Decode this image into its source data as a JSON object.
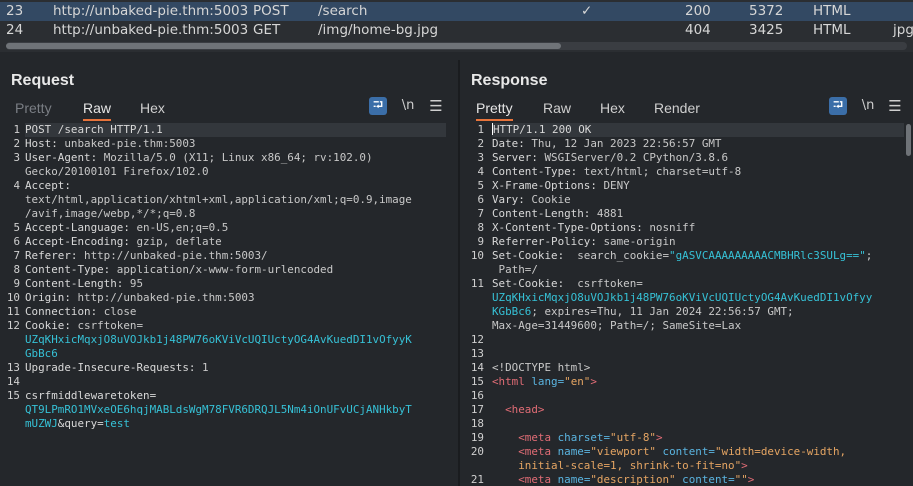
{
  "history": {
    "rows": [
      {
        "num": "23",
        "host": "http://unbaked-pie.thm:5003",
        "method": "POST",
        "path": "/search",
        "check": "✓",
        "status": "200",
        "length": "5372",
        "mime": "HTML",
        "ext": ""
      },
      {
        "num": "24",
        "host": "http://unbaked-pie.thm:5003",
        "method": "GET",
        "path": "/img/home-bg.jpg",
        "check": "",
        "status": "404",
        "length": "3425",
        "mime": "HTML",
        "ext": "jpg"
      }
    ]
  },
  "request": {
    "title": "Request",
    "tabs": [
      "Pretty",
      "Raw",
      "Hex"
    ],
    "active_tab": "Raw",
    "newline_label": "\\n",
    "lines": [
      {
        "n": "1",
        "parts": [
          [
            "k",
            "POST /search HTTP/1.1"
          ]
        ]
      },
      {
        "n": "2",
        "parts": [
          [
            "k",
            "Host: "
          ],
          [
            "v",
            "unbaked-pie.thm:5003"
          ]
        ]
      },
      {
        "n": "3",
        "parts": [
          [
            "k",
            "User-Agent: "
          ],
          [
            "v",
            "Mozilla/5.0 (X11; Linux x86_64; rv:102.0)"
          ]
        ]
      },
      {
        "n": "",
        "parts": [
          [
            "v",
            "Gecko/20100101 Firefox/102.0"
          ]
        ]
      },
      {
        "n": "4",
        "parts": [
          [
            "k",
            "Accept: "
          ]
        ]
      },
      {
        "n": "",
        "parts": [
          [
            "v",
            "text/html,application/xhtml+xml,application/xml;q=0.9,image"
          ]
        ]
      },
      {
        "n": "",
        "parts": [
          [
            "v",
            "/avif,image/webp,*/*;q=0.8"
          ]
        ]
      },
      {
        "n": "5",
        "parts": [
          [
            "k",
            "Accept-Language: "
          ],
          [
            "v",
            "en-US,en;q=0.5"
          ]
        ]
      },
      {
        "n": "6",
        "parts": [
          [
            "k",
            "Accept-Encoding: "
          ],
          [
            "v",
            "gzip, deflate"
          ]
        ]
      },
      {
        "n": "7",
        "parts": [
          [
            "k",
            "Referer: "
          ],
          [
            "v",
            "http://unbaked-pie.thm:5003/"
          ]
        ]
      },
      {
        "n": "8",
        "parts": [
          [
            "k",
            "Content-Type: "
          ],
          [
            "v",
            "application/x-www-form-urlencoded"
          ]
        ]
      },
      {
        "n": "9",
        "parts": [
          [
            "k",
            "Content-Length: "
          ],
          [
            "v",
            "95"
          ]
        ]
      },
      {
        "n": "10",
        "parts": [
          [
            "k",
            "Origin: "
          ],
          [
            "v",
            "http://unbaked-pie.thm:5003"
          ]
        ]
      },
      {
        "n": "11",
        "parts": [
          [
            "k",
            "Connection: "
          ],
          [
            "v",
            "close"
          ]
        ]
      },
      {
        "n": "12",
        "parts": [
          [
            "k",
            "Cookie: "
          ],
          [
            "v",
            "csrftoken="
          ]
        ]
      },
      {
        "n": "",
        "parts": [
          [
            "cyan",
            "UZqKHxicMqxjO8uVOJkb1j48PW76oKViVcUQIUctyOG4AvKuedDI1vOfyyK"
          ]
        ]
      },
      {
        "n": "",
        "parts": [
          [
            "cyan",
            "GbBc6"
          ]
        ]
      },
      {
        "n": "13",
        "parts": [
          [
            "k",
            "Upgrade-Insecure-Requests: "
          ],
          [
            "v",
            "1"
          ]
        ]
      },
      {
        "n": "14",
        "parts": []
      },
      {
        "n": "15",
        "parts": [
          [
            "k",
            "csrfmiddlewaretoken="
          ]
        ]
      },
      {
        "n": "",
        "parts": [
          [
            "cyan",
            "QT9LPmRO1MVxeOE6hqjMABLdsWgM78FVR6DRQJL5Nm4iOnUFvUCjANHkbyT"
          ]
        ]
      },
      {
        "n": "",
        "parts": [
          [
            "cyan",
            "mUZWJ"
          ],
          [
            "k",
            "&query="
          ],
          [
            "cyan",
            "test"
          ]
        ]
      }
    ]
  },
  "response": {
    "title": "Response",
    "tabs": [
      "Pretty",
      "Raw",
      "Hex",
      "Render"
    ],
    "active_tab": "Pretty",
    "newline_label": "\\n",
    "lines": [
      {
        "n": "1",
        "parts": [
          [
            "k",
            "HTTP/1.1 200 OK"
          ]
        ]
      },
      {
        "n": "2",
        "parts": [
          [
            "k",
            "Date: "
          ],
          [
            "v",
            "Thu, 12 Jan 2023 22:56:57 GMT"
          ]
        ]
      },
      {
        "n": "3",
        "parts": [
          [
            "k",
            "Server: "
          ],
          [
            "v",
            "WSGIServer/0.2 CPython/3.8.6"
          ]
        ]
      },
      {
        "n": "4",
        "parts": [
          [
            "k",
            "Content-Type: "
          ],
          [
            "v",
            "text/html; charset=utf-8"
          ]
        ]
      },
      {
        "n": "5",
        "parts": [
          [
            "k",
            "X-Frame-Options: "
          ],
          [
            "v",
            "DENY"
          ]
        ]
      },
      {
        "n": "6",
        "parts": [
          [
            "k",
            "Vary: "
          ],
          [
            "v",
            "Cookie"
          ]
        ]
      },
      {
        "n": "7",
        "parts": [
          [
            "k",
            "Content-Length: "
          ],
          [
            "v",
            "4881"
          ]
        ]
      },
      {
        "n": "8",
        "parts": [
          [
            "k",
            "X-Content-Type-Options: "
          ],
          [
            "v",
            "nosniff"
          ]
        ]
      },
      {
        "n": "9",
        "parts": [
          [
            "k",
            "Referrer-Policy: "
          ],
          [
            "v",
            "same-origin"
          ]
        ]
      },
      {
        "n": "10",
        "parts": [
          [
            "k",
            "Set-Cookie: "
          ],
          [
            "v",
            " search_cookie="
          ],
          [
            "cyan",
            "\"gASVCAAAAAAAAACMBHRlc3SULg==\""
          ],
          [
            "v",
            ";"
          ]
        ]
      },
      {
        "n": "",
        "parts": [
          [
            "v",
            " Path=/"
          ]
        ]
      },
      {
        "n": "11",
        "parts": [
          [
            "k",
            "Set-Cookie: "
          ],
          [
            "v",
            " csrftoken="
          ]
        ]
      },
      {
        "n": "",
        "parts": [
          [
            "cyan",
            "UZqKHxicMqxjO8uVOJkb1j48PW76oKViVcUQIUctyOG4AvKuedDI1vOfyy"
          ]
        ]
      },
      {
        "n": "",
        "parts": [
          [
            "cyan",
            "KGbBc6"
          ],
          [
            "v",
            "; expires=Thu, 11 Jan 2024 22:56:57 GMT;"
          ]
        ]
      },
      {
        "n": "",
        "parts": [
          [
            "v",
            "Max-Age=31449600; Path=/; SameSite=Lax"
          ]
        ]
      },
      {
        "n": "12",
        "parts": []
      },
      {
        "n": "13",
        "parts": []
      },
      {
        "n": "14",
        "parts": [
          [
            "v",
            "<!DOCTYPE html>"
          ]
        ]
      },
      {
        "n": "15",
        "parts": [
          [
            "tag",
            "<html"
          ],
          [
            "attr",
            " lang="
          ],
          [
            "str",
            "\"en\""
          ],
          [
            "tag",
            ">"
          ]
        ]
      },
      {
        "n": "16",
        "parts": []
      },
      {
        "n": "17",
        "parts": [
          [
            "v",
            "  "
          ],
          [
            "tag",
            "<head>"
          ]
        ]
      },
      {
        "n": "18",
        "parts": []
      },
      {
        "n": "19",
        "parts": [
          [
            "v",
            "    "
          ],
          [
            "tag",
            "<meta"
          ],
          [
            "attr",
            " charset="
          ],
          [
            "str",
            "\"utf-8\""
          ],
          [
            "tag",
            ">"
          ]
        ]
      },
      {
        "n": "20",
        "parts": [
          [
            "v",
            "    "
          ],
          [
            "tag",
            "<meta"
          ],
          [
            "attr",
            " name="
          ],
          [
            "str",
            "\"viewport\""
          ],
          [
            "attr",
            " content="
          ],
          [
            "str",
            "\"width=device-width,"
          ]
        ]
      },
      {
        "n": "",
        "parts": [
          [
            "str",
            "    initial-scale=1, shrink-to-fit=no\""
          ],
          [
            "tag",
            ">"
          ]
        ]
      },
      {
        "n": "21",
        "parts": [
          [
            "v",
            "    "
          ],
          [
            "tag",
            "<meta"
          ],
          [
            "attr",
            " name="
          ],
          [
            "str",
            "\"description\""
          ],
          [
            "attr",
            " content="
          ],
          [
            "str",
            "\"\""
          ],
          [
            "tag",
            ">"
          ]
        ]
      }
    ]
  }
}
